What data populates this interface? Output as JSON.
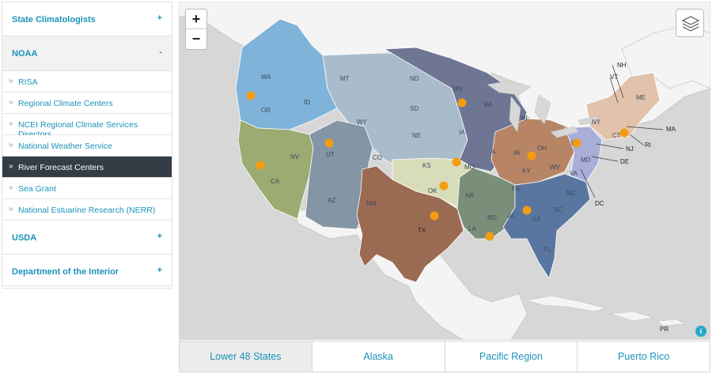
{
  "sidebar": {
    "groups": [
      {
        "label": "State Climatologists",
        "sign": "+"
      },
      {
        "label": "NOAA",
        "sign": "-"
      },
      {
        "label": "USDA",
        "sign": "+"
      },
      {
        "label": "Department of the Interior",
        "sign": "+"
      }
    ],
    "noaa_items": [
      {
        "label": "RISA",
        "chev": "»"
      },
      {
        "label": "Regional Climate Centers",
        "chev": "»"
      },
      {
        "label": "NCEI Regional Climate Services Directors",
        "chev": "»"
      },
      {
        "label": "National Weather Service",
        "chev": "»"
      },
      {
        "label": "River Forecast Centers",
        "chev": "»"
      },
      {
        "label": "Sea Grant",
        "chev": "»"
      },
      {
        "label": "National Estuarine Research (NERR)",
        "chev": "»"
      }
    ],
    "active_item": "River Forecast Centers"
  },
  "map": {
    "zoom_in": "+",
    "zoom_out": "−",
    "info": "i",
    "state_labels": {
      "WA": "WA",
      "OR": "OR",
      "ID": "ID",
      "MT": "MT",
      "WY": "WY",
      "NV": "NV",
      "UT": "UT",
      "CA": "CA",
      "AZ": "AZ",
      "NM": "NM",
      "CO": "CO",
      "ND": "ND",
      "SD": "SD",
      "NE": "NE",
      "KS": "KS",
      "OK": "OK",
      "TX": "TX",
      "MN": "MN",
      "IA": "IA",
      "MO": "MO",
      "AR": "AR",
      "LA": "LA",
      "WI": "WI",
      "IL": "IL",
      "MI": "MI",
      "IN": "IN",
      "OH": "OH",
      "KY": "KY",
      "TN": "TN",
      "MS": "MS",
      "AL": "AL",
      "GA": "GA",
      "FL": "FL",
      "SC": "SC",
      "NC": "NC",
      "VA": "VA",
      "WV": "WV",
      "PA": "PA",
      "NY": "NY",
      "ME": "ME",
      "VT": "VT",
      "NH": "NH",
      "MA": "MA",
      "CT": "CT",
      "RI": "RI",
      "NJ": "NJ",
      "DE": "DE",
      "MD": "MD",
      "DC": "DC",
      "PR": "PR"
    },
    "colors": {
      "northwest": "#7fb3d9",
      "missouri": "#a9bccb",
      "west_gulf": "#9b6a52",
      "california": "#9bab72",
      "colorado": "#8495a5",
      "arkansas": "#d9dcb8",
      "north_central": "#6e7694",
      "ohio": "#b88466",
      "lower_miss": "#7a8f79",
      "southeast": "#5976a0",
      "mid_atlantic": "#a8aed8",
      "northeast": "#e2c2aa",
      "marker": "#f39c12",
      "land": "#f4f4f4",
      "water": "#d7d7d7"
    }
  },
  "tabs": [
    {
      "label": "Lower 48 States"
    },
    {
      "label": "Alaska"
    },
    {
      "label": "Pacific Region"
    },
    {
      "label": "Puerto Rico"
    }
  ],
  "active_tab": "Lower 48 States"
}
